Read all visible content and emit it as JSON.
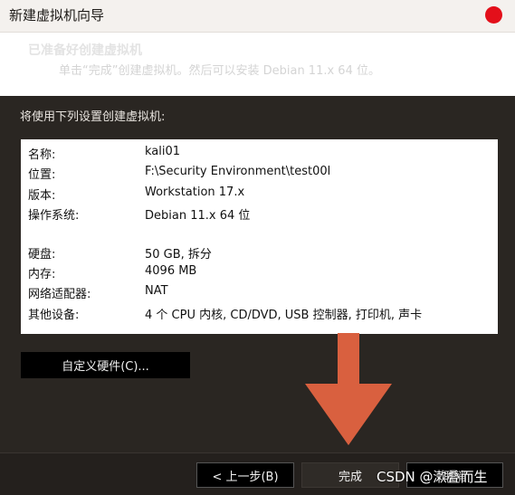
{
  "window": {
    "title": "新建虚拟机向导"
  },
  "header": {
    "title": "已准备好创建虚拟机",
    "subtitle": "单击“完成”创建虚拟机。然后可以安装 Debian 11.x 64 位。"
  },
  "intro": "将使用下列设置创建虚拟机:",
  "summary": {
    "rows": [
      {
        "label": "名称:",
        "value": "kali01"
      },
      {
        "label": "位置:",
        "value": "F:\\Security Environment\\test00l"
      },
      {
        "label": "版本:",
        "value": "Workstation 17.x"
      },
      {
        "label": "操作系统:",
        "value": "Debian 11.x 64 位"
      },
      {
        "label": "硬盘:",
        "value": "50 GB, 拆分"
      },
      {
        "label": "内存:",
        "value": "4096 MB"
      },
      {
        "label": "网络适配器:",
        "value": "NAT"
      },
      {
        "label": "其他设备:",
        "value": "4 个 CPU 内核, CD/DVD, USB 控制器, 打印机, 声卡"
      }
    ]
  },
  "buttons": {
    "customize": "自定义硬件(C)...",
    "back": "< 上一步(B)",
    "finish": "完成",
    "cancel": "取消"
  },
  "watermark": "CSDN @漱叠而生",
  "colors": {
    "close": "#e30f1a",
    "arrow": "#d9603f"
  },
  "icons": {
    "annotation": "down-arrow-icon",
    "close": "close-icon"
  }
}
